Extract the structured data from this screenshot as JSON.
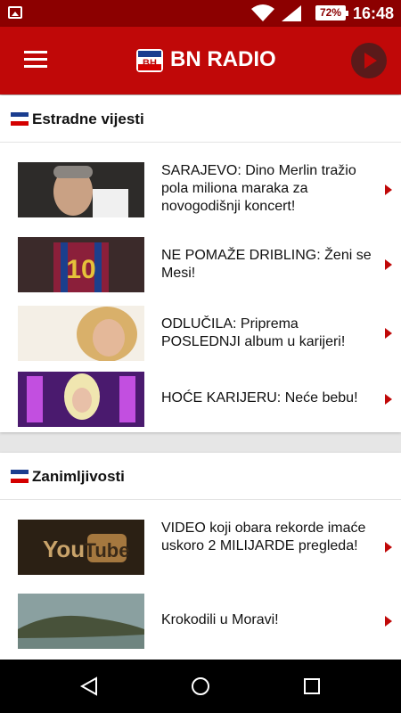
{
  "status_bar": {
    "time": "16:48",
    "battery": "72%"
  },
  "app_bar": {
    "title": "BN RADIO"
  },
  "sections": [
    {
      "title": "Estradne vijesti",
      "items": [
        {
          "title": "SARAJEVO: Dino Merlin tražio pola miliona maraka za novogodišnji koncert!"
        },
        {
          "title": "NE POMAŽE DRIBLING: Ženi se Mesi!"
        },
        {
          "title": "ODLUČILA: Priprema POSLEDNJI album u karijeri!"
        },
        {
          "title": "HOĆE KARIJERU: Neće bebu!"
        }
      ]
    },
    {
      "title": "Zanimljivosti",
      "items": [
        {
          "title": "VIDEO koji obara rekorde imaće uskoro 2 MILIJARDE pregleda!"
        },
        {
          "title": "Krokodili u Moravi!"
        }
      ]
    }
  ],
  "colors": {
    "status_bar": "#8c0000",
    "app_bar": "#c00808",
    "accent": "#c00808"
  }
}
